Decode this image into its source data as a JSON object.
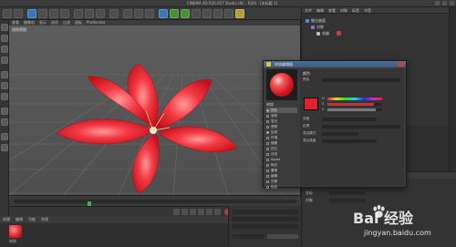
{
  "window": {
    "title": "CINEMA 4D R20.057 Studio (RC - R20) - [未标题 1]"
  },
  "viewport": {
    "menu": [
      "查看",
      "摄像机",
      "显示",
      "选项",
      "过滤",
      "面板",
      "ProRender"
    ],
    "label": "透视视图"
  },
  "object_manager": {
    "menu": [
      "文件",
      "编辑",
      "查看",
      "对象",
      "标签",
      "书签"
    ],
    "rows": [
      "细分曲面",
      "对称",
      "花瓣"
    ]
  },
  "material_manager": {
    "menu": [
      "创建",
      "编辑",
      "功能",
      "纹理"
    ],
    "material_name": "材质"
  },
  "attribute_manager": {
    "menu": [
      "模式",
      "编辑",
      "用户数据"
    ],
    "rows": [
      "基本",
      "坐标",
      "对象"
    ]
  },
  "material_editor": {
    "title": "材质编辑器",
    "name": "材质",
    "channels": [
      {
        "label": "颜色",
        "on": true
      },
      {
        "label": "漫射",
        "on": false
      },
      {
        "label": "发光",
        "on": false
      },
      {
        "label": "透明",
        "on": false
      },
      {
        "label": "反射",
        "on": true
      },
      {
        "label": "环境",
        "on": false
      },
      {
        "label": "烟雾",
        "on": false
      },
      {
        "label": "凹凸",
        "on": false
      },
      {
        "label": "法线",
        "on": false
      },
      {
        "label": "Alpha",
        "on": false
      },
      {
        "label": "辉光",
        "on": false
      },
      {
        "label": "置换",
        "on": false
      },
      {
        "label": "编辑",
        "on": false
      },
      {
        "label": "光照",
        "on": false
      },
      {
        "label": "指定",
        "on": false
      }
    ],
    "section_title": "颜色",
    "props": [
      "颜色",
      "H",
      "S",
      "V",
      "亮度",
      "纹理",
      "混合模式",
      "混合强度"
    ],
    "accent_color": "#e0222c"
  },
  "timeline": {
    "marker_fraction": 0.26
  },
  "watermark": {
    "brand": "Bai  经验",
    "url": "jingyan.baidu.com"
  }
}
